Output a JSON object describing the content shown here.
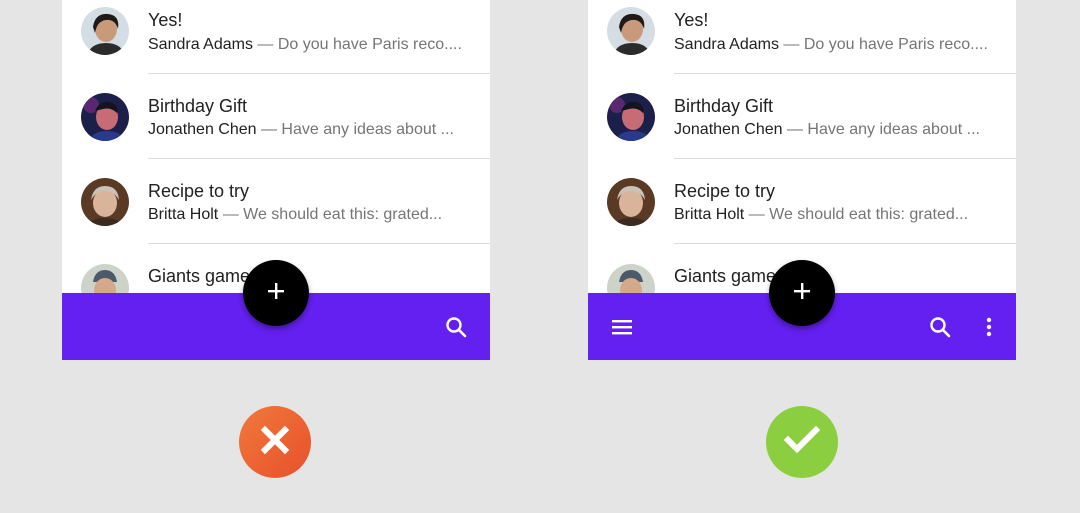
{
  "colors": {
    "background": "#e5e5e5",
    "app_bar": "#6420f0",
    "fab": "#000000",
    "bad_indicator": "#ec6531",
    "good_indicator": "#8bce3f",
    "divider": "#dcdcdc",
    "primary_text": "#212121",
    "secondary_text": "#757575"
  },
  "examples": [
    {
      "variant": "incorrect",
      "messages": [
        {
          "subject": "Yes!",
          "sender": "Sandra Adams",
          "preview": " — Do you have Paris reco...."
        },
        {
          "subject": "Birthday Gift",
          "sender": "Jonathen Chen",
          "preview": " — Have any ideas about ..."
        },
        {
          "subject": "Recipe to try",
          "sender": "Britta Holt",
          "preview": " — We should eat this: grated..."
        },
        {
          "subject": "Giants game",
          "sender": "",
          "preview": ""
        }
      ],
      "app_bar_icons": [
        "search-icon"
      ],
      "fab_icon": "add-icon",
      "indicator_icon": "close-icon"
    },
    {
      "variant": "correct",
      "messages": [
        {
          "subject": "Yes!",
          "sender": "Sandra Adams",
          "preview": " — Do you have Paris reco...."
        },
        {
          "subject": "Birthday Gift",
          "sender": "Jonathen Chen",
          "preview": " — Have any ideas about ..."
        },
        {
          "subject": "Recipe to try",
          "sender": "Britta Holt",
          "preview": " — We should eat this: grated..."
        },
        {
          "subject": "Giants game",
          "sender": "",
          "preview": ""
        }
      ],
      "app_bar_icons": [
        "menu-icon",
        "search-icon",
        "more-vert-icon"
      ],
      "fab_icon": "add-icon",
      "indicator_icon": "check-icon"
    }
  ]
}
